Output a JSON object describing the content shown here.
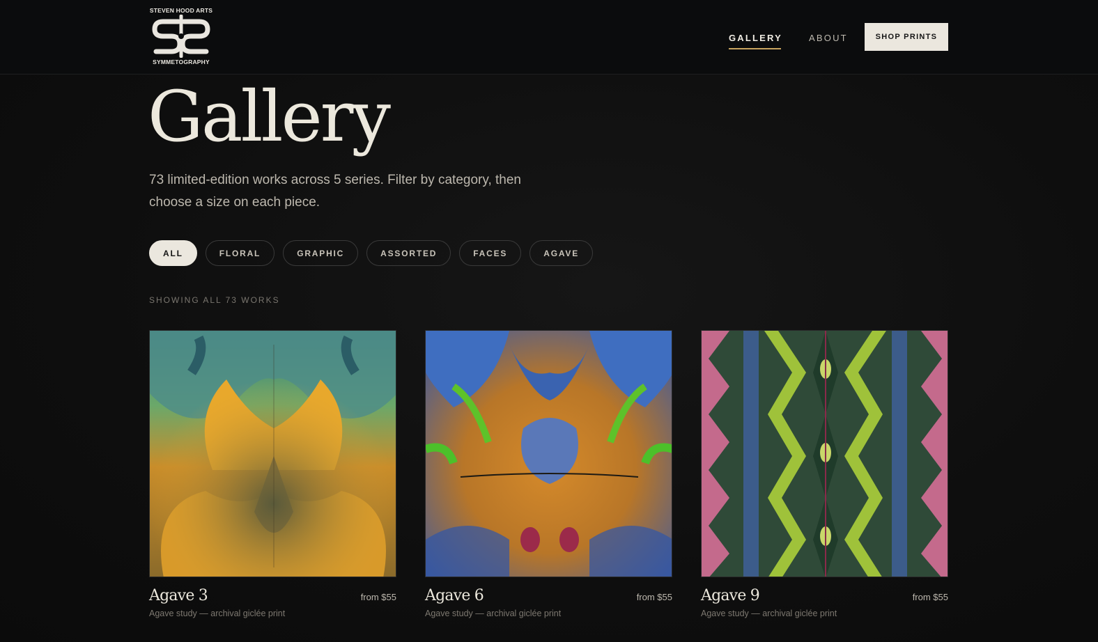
{
  "brand": {
    "top_text": "STEVEN HOOD ARTS",
    "bottom_text": "SYMMETOGRAPHY",
    "logo_icon": "sh-monogram-icon"
  },
  "nav": {
    "items": [
      {
        "label": "GALLERY",
        "active": true
      },
      {
        "label": "ABOUT",
        "active": false
      }
    ],
    "cta": "SHOP PRINTS"
  },
  "page": {
    "title": "Gallery",
    "intro": "73 limited-edition works across 5 series. Filter by category, then choose a size on each piece.",
    "count_label": "SHOWING ALL 73 WORKS"
  },
  "filters": [
    {
      "label": "ALL",
      "active": true
    },
    {
      "label": "FLORAL",
      "active": false
    },
    {
      "label": "GRAPHIC",
      "active": false
    },
    {
      "label": "ASSORTED",
      "active": false
    },
    {
      "label": "FACES",
      "active": false
    },
    {
      "label": "AGAVE",
      "active": false
    }
  ],
  "works": [
    {
      "name": "Agave 3",
      "price": "from $55",
      "description": "Agave study — archival giclée print"
    },
    {
      "name": "Agave 6",
      "price": "from $55",
      "description": "Agave study — archival giclée print"
    },
    {
      "name": "Agave 9",
      "price": "from $55",
      "description": "Agave study — archival giclée print"
    }
  ],
  "colors": {
    "background": "#0f0f0f",
    "text": "#ece8dd",
    "accent": "#c9a45f",
    "chip_active": "#ebe7de"
  }
}
